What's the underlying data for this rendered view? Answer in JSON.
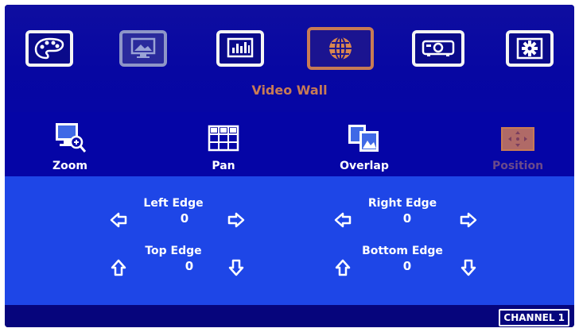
{
  "menu": {
    "title": "Video Wall",
    "items": [
      {
        "icon": "palette-icon",
        "state": "normal"
      },
      {
        "icon": "monitor-picture-icon",
        "state": "dim"
      },
      {
        "icon": "audio-levels-icon",
        "state": "normal"
      },
      {
        "icon": "globe-icon",
        "state": "active"
      },
      {
        "icon": "projector-icon",
        "state": "normal"
      },
      {
        "icon": "gear-icon",
        "state": "normal"
      }
    ]
  },
  "submenu": {
    "items": [
      {
        "label": "Zoom",
        "icon": "zoom-icon"
      },
      {
        "label": "Pan",
        "icon": "grid-pan-icon"
      },
      {
        "label": "Overlap",
        "icon": "overlap-icon"
      },
      {
        "label": "Position",
        "icon": "position-icon",
        "disabled": true
      }
    ]
  },
  "edges": {
    "left": {
      "label": "Left Edge",
      "value": "0"
    },
    "right": {
      "label": "Right Edge",
      "value": "0"
    },
    "top": {
      "label": "Top Edge",
      "value": "0"
    },
    "bottom": {
      "label": "Bottom Edge",
      "value": "0"
    }
  },
  "status": {
    "channel": "CHANNEL 1"
  },
  "colors": {
    "background": "#06057c",
    "panel": "#1e46e7",
    "accent": "#c77b55",
    "text": "#ffffff"
  }
}
